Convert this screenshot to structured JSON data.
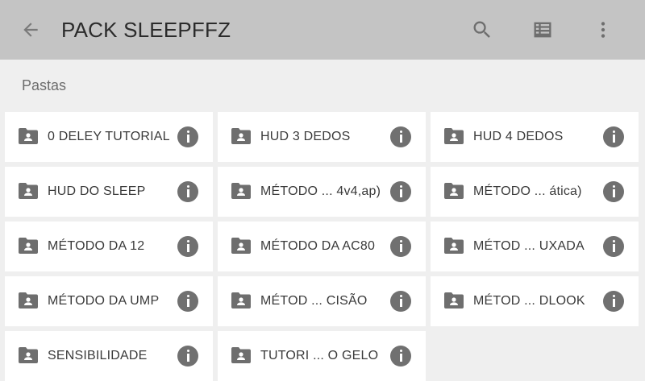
{
  "app_bar": {
    "title": "PACK SLEEPFFZ",
    "back_icon": "arrow-back-icon",
    "actions": [
      "search-icon",
      "list-view-icon",
      "more-vert-icon"
    ]
  },
  "section": {
    "title": "Pastas"
  },
  "folders": [
    {
      "label": "0 DELEY TUTORIAL"
    },
    {
      "label": "HUD 3 DEDOS"
    },
    {
      "label": "HUD 4 DEDOS"
    },
    {
      "label": "HUD DO SLEEP"
    },
    {
      "label": "MÉTODO ... 4v4,ap)"
    },
    {
      "label": "MÉTODO ... ática)"
    },
    {
      "label": "MÉTODO DA 12"
    },
    {
      "label": "MÉTODO DA AC80"
    },
    {
      "label": "MÉTOD ... UXADA"
    },
    {
      "label": "MÉTODO DA UMP"
    },
    {
      "label": "MÉTOD ... CISÃO"
    },
    {
      "label": "MÉTOD ... DLOOK"
    },
    {
      "label": "SENSIBILIDADE"
    },
    {
      "label": "TUTORI ... O GELO"
    }
  ],
  "colors": {
    "toolbar": "#c4c4c4",
    "background": "#efefef",
    "card": "#ffffff",
    "icon": "#6e6e6e"
  }
}
